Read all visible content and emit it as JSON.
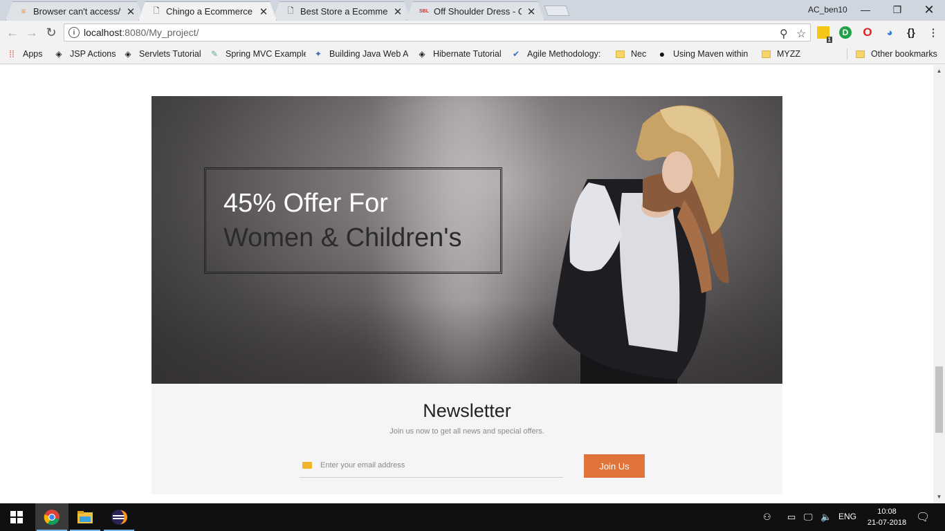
{
  "browser": {
    "tabs": [
      {
        "title": "Browser can't access/find",
        "favicon": "stackoverflow-icon",
        "active": false
      },
      {
        "title": "Chingo a Ecommerce On",
        "favicon": "page-icon",
        "active": true
      },
      {
        "title": "Best Store a Ecommerce",
        "favicon": "page-icon",
        "active": false
      },
      {
        "title": "Off Shoulder Dress - Onli",
        "favicon": "sbl-icon",
        "active": false
      }
    ],
    "profile_name": "AC_ben10",
    "url_host": "localhost",
    "url_path": ":8080/My_project/",
    "extension_badge": "1",
    "bookmarks": [
      {
        "label": "Apps"
      },
      {
        "label": "JSP Actions"
      },
      {
        "label": "Servlets Tutorial"
      },
      {
        "label": "Spring MVC Example"
      },
      {
        "label": "Building Java Web A"
      },
      {
        "label": "Hibernate Tutorial"
      },
      {
        "label": "Agile Methodology:"
      },
      {
        "label": "Nec"
      },
      {
        "label": "Using Maven within"
      },
      {
        "label": "MYZZ"
      },
      {
        "label": "Other bookmarks"
      }
    ]
  },
  "page": {
    "banner": {
      "line1": "45% Offer For",
      "line2": "Women & Children's"
    },
    "newsletter": {
      "title": "Newsletter",
      "subtitle": "Join us now to get all news and special offers.",
      "email_placeholder": "Enter your email address",
      "button_label": "Join Us"
    },
    "colors": {
      "accent": "#e0733a",
      "newsletter_bg": "#f5f5f7"
    }
  },
  "taskbar": {
    "language": "ENG",
    "time": "10:08",
    "date": "21-07-2018"
  }
}
